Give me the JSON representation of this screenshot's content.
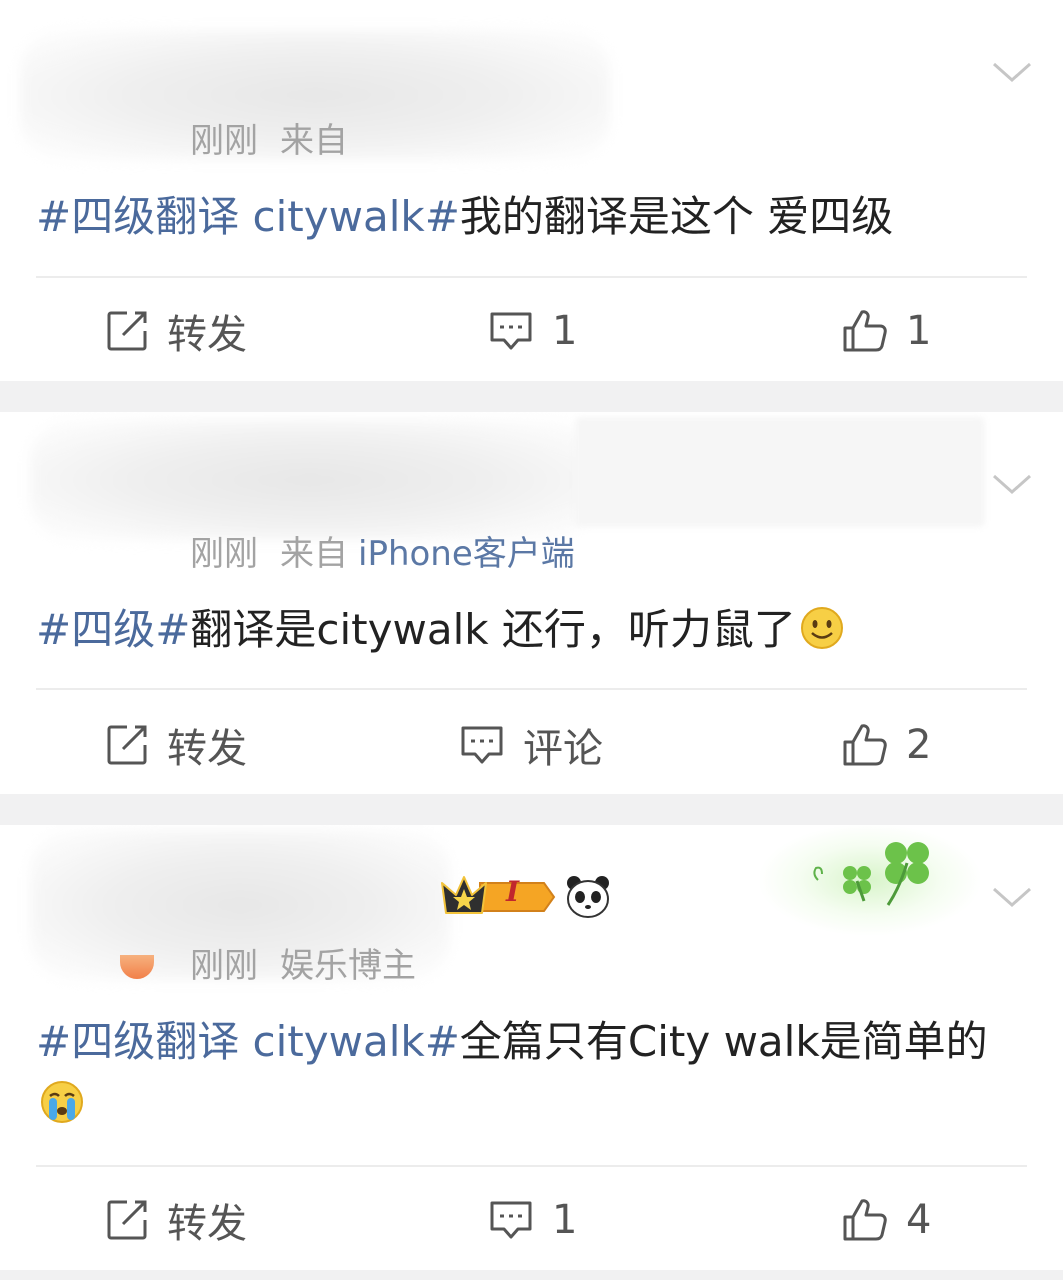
{
  "posts": [
    {
      "time": "刚刚",
      "source_prefix": "来自",
      "source_name": "",
      "topic": "#四级翻译 citywalk#",
      "text": "我的翻译是这个 爱四级",
      "actions": {
        "repost_label": "转发",
        "comment_value": "1",
        "like_value": "1"
      }
    },
    {
      "time": "刚刚",
      "source_prefix": "来自",
      "source_name": "iPhone客户端",
      "topic": "#四级#",
      "text": "翻译是citywalk 还行，听力鼠了",
      "actions": {
        "repost_label": "转发",
        "comment_value": "评论",
        "like_value": "2"
      }
    },
    {
      "time": "刚刚",
      "source_prefix": "娱乐博主",
      "source_name": "",
      "topic": "#四级翻译 citywalk#",
      "text": "全篇只有City walk是简单的",
      "badge_level": "I",
      "actions": {
        "repost_label": "转发",
        "comment_value": "1",
        "like_value": "4"
      }
    }
  ],
  "icons": {
    "repost": "share-edit-icon",
    "comment": "comment-bubble-icon",
    "like": "thumbs-up-icon",
    "menu": "chevron-down-icon"
  },
  "colors": {
    "topic": "#4b6a9c",
    "source": "#5b78a5",
    "meta": "#a3a3a3",
    "separator": "#f1f1f2"
  }
}
